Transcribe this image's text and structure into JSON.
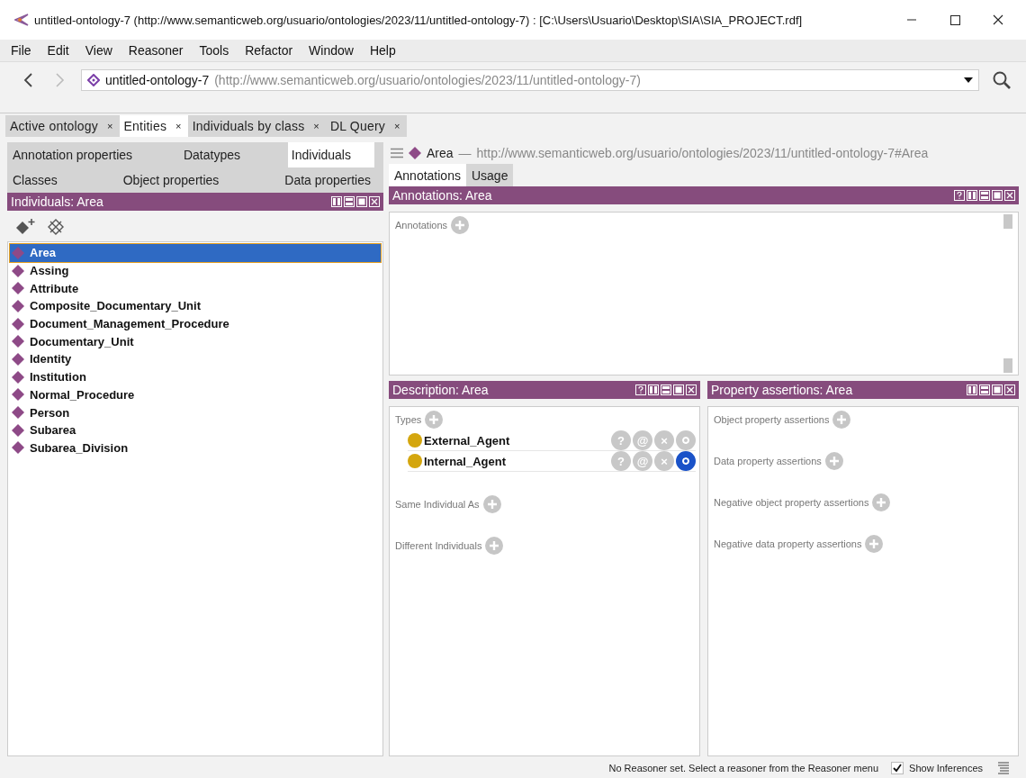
{
  "window": {
    "title": "untitled-ontology-7 (http://www.semanticweb.org/usuario/ontologies/2023/11/untitled-ontology-7)  : [C:\\Users\\Usuario\\Desktop\\SIA\\SIA_PROJECT.rdf]"
  },
  "menu": [
    "File",
    "Edit",
    "View",
    "Reasoner",
    "Tools",
    "Refactor",
    "Window",
    "Help"
  ],
  "address": {
    "name": "untitled-ontology-7",
    "iri": "(http://www.semanticweb.org/usuario/ontologies/2023/11/untitled-ontology-7)"
  },
  "workspace_tabs": [
    {
      "label": "Active ontology",
      "selected": false
    },
    {
      "label": "Entities",
      "selected": true
    },
    {
      "label": "Individuals by class",
      "selected": false
    },
    {
      "label": "DL Query",
      "selected": false
    }
  ],
  "tab_close": "×",
  "entity_tabs": [
    [
      {
        "label": "Annotation properties",
        "selected": false
      },
      {
        "label": "Datatypes",
        "selected": false
      },
      {
        "label": "Individuals",
        "selected": true
      }
    ],
    [
      {
        "label": "Classes",
        "selected": false
      },
      {
        "label": "Object properties",
        "selected": false
      },
      {
        "label": "Data properties",
        "selected": false
      }
    ]
  ],
  "individuals_view": {
    "title": "Individuals: Area",
    "controls": [
      {
        "kind": "split_v"
      },
      {
        "kind": "split_h"
      },
      {
        "kind": "maximize"
      },
      {
        "kind": "close"
      }
    ],
    "items": [
      {
        "label": "Area",
        "selected": true
      },
      {
        "label": "Assing",
        "selected": false
      },
      {
        "label": "Attribute",
        "selected": false
      },
      {
        "label": "Composite_Documentary_Unit",
        "selected": false
      },
      {
        "label": "Document_Management_Procedure",
        "selected": false
      },
      {
        "label": "Documentary_Unit",
        "selected": false
      },
      {
        "label": "Identity",
        "selected": false
      },
      {
        "label": "Institution",
        "selected": false
      },
      {
        "label": "Normal_Procedure",
        "selected": false
      },
      {
        "label": "Person",
        "selected": false
      },
      {
        "label": "Subarea",
        "selected": false
      },
      {
        "label": "Subarea_Division",
        "selected": false
      }
    ]
  },
  "entity_header": {
    "name": "Area",
    "separator": "—",
    "iri": "http://www.semanticweb.org/usuario/ontologies/2023/11/untitled-ontology-7#Area"
  },
  "view_tabs": [
    {
      "label": "Annotations",
      "selected": true
    },
    {
      "label": "Usage",
      "selected": false
    }
  ],
  "annotations_view": {
    "title": "Annotations: Area",
    "controls": [
      {
        "kind": "help"
      },
      {
        "kind": "split_v"
      },
      {
        "kind": "split_h"
      },
      {
        "kind": "maximize"
      },
      {
        "kind": "close"
      }
    ],
    "section": "Annotations"
  },
  "description_view": {
    "title": "Description: Area",
    "controls": [
      {
        "kind": "help"
      },
      {
        "kind": "split_v"
      },
      {
        "kind": "split_h"
      },
      {
        "kind": "maximize"
      },
      {
        "kind": "close"
      }
    ],
    "types_label": "Types",
    "row_actions": [
      "?",
      "@",
      "×"
    ],
    "types": [
      {
        "label": "External_Agent",
        "selected": false
      },
      {
        "label": "Internal_Agent",
        "selected": true
      }
    ],
    "sections": [
      "Same Individual As",
      "Different Individuals"
    ]
  },
  "property_view": {
    "title": "Property assertions: Area",
    "controls": [
      {
        "kind": "split_v"
      },
      {
        "kind": "split_h"
      },
      {
        "kind": "maximize"
      },
      {
        "kind": "close"
      }
    ],
    "sections": [
      "Object property assertions",
      "Data property assertions",
      "Negative object property assertions",
      "Negative data property assertions"
    ]
  },
  "status_bar": {
    "message": "No Reasoner set. Select a reasoner from the Reasoner menu",
    "show_inferences": {
      "label": "Show Inferences",
      "checked": true
    }
  }
}
